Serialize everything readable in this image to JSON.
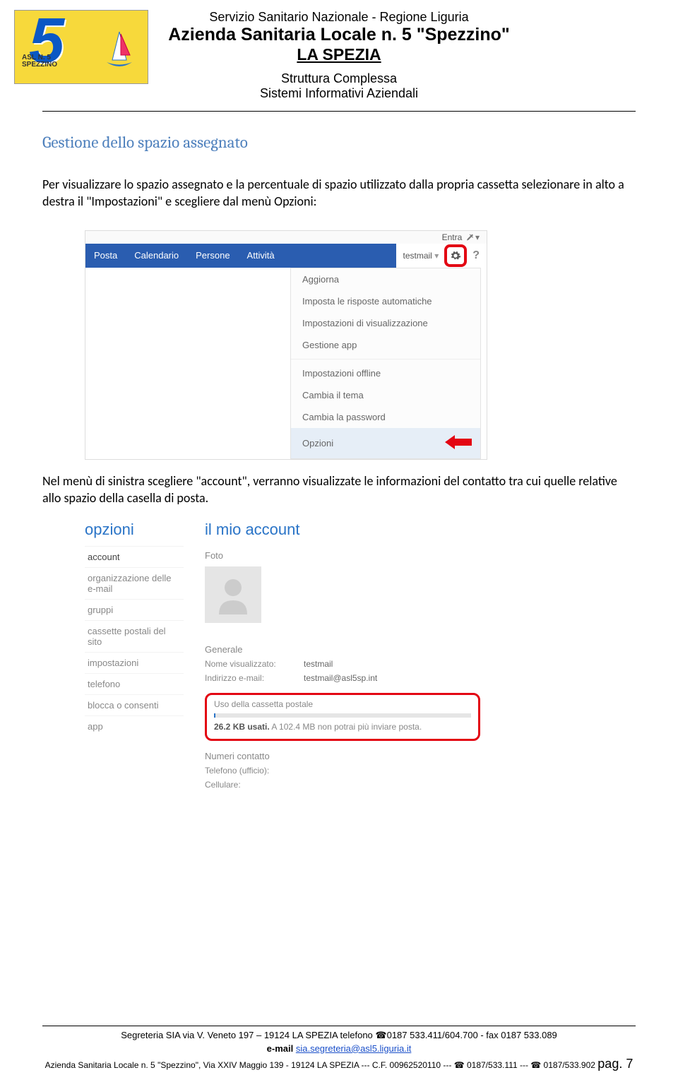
{
  "header": {
    "logo_text1": "ASL N. 5",
    "logo_text2": "SPEZZINO",
    "line1": "Servizio Sanitario Nazionale - Regione Liguria",
    "line2": "Azienda Sanitaria Locale n. 5 \"Spezzino\"",
    "line3": "LA SPEZIA",
    "line4": "Struttura Complessa",
    "line5": "Sistemi Informativi Aziendali"
  },
  "section_title": "Gestione dello spazio assegnato",
  "paragraph1": "Per visualizzare lo spazio assegnato e la percentuale di spazio utilizzato dalla propria cassetta selezionare in alto a destra il \"Impostazioni\" e scegliere dal menù Opzioni:",
  "screenshot1": {
    "entra": "Entra",
    "nav": {
      "posta": "Posta",
      "calendario": "Calendario",
      "persone": "Persone",
      "attivita": "Attività"
    },
    "user": "testmail",
    "help": "?",
    "dropdown": {
      "aggiorna": "Aggiorna",
      "risposte": "Imposta le risposte automatiche",
      "visualizzazione": "Impostazioni di visualizzazione",
      "gestione_app": "Gestione app",
      "offline": "Impostazioni offline",
      "tema": "Cambia il tema",
      "password": "Cambia la password",
      "opzioni": "Opzioni"
    }
  },
  "paragraph2": "Nel  menù di sinistra scegliere \"account\", verranno visualizzate le informazioni del contatto tra cui quelle relative allo spazio della casella di posta.",
  "screenshot2": {
    "sidebar": {
      "title": "opzioni",
      "items": {
        "account": "account",
        "org": "organizzazione delle e-mail",
        "gruppi": "gruppi",
        "cassette": "cassette postali del sito",
        "impostazioni": "impostazioni",
        "telefono": "telefono",
        "blocca": "blocca o consenti",
        "app": "app"
      }
    },
    "main": {
      "title": "il mio account",
      "foto": "Foto",
      "generale": "Generale",
      "nome_visualizzato_k": "Nome visualizzato:",
      "nome_visualizzato_v": "testmail",
      "indirizzo_k": "Indirizzo e-mail:",
      "indirizzo_v": "testmail@asl5sp.int",
      "uso_label": "Uso della cassetta postale",
      "uso_line": "26.2 KB usati. A 102.4 MB non potrai più inviare posta.",
      "uso_bold": "26.2 KB usati.",
      "uso_rest": " A 102.4 MB non potrai più inviare posta.",
      "numeri": "Numeri contatto",
      "tel_ufficio": "Telefono (ufficio):",
      "cellulare": "Cellulare:"
    }
  },
  "footer": {
    "line1": "Segreteria SIA via V. Veneto 197 – 19124 LA SPEZIA  telefono ☎0187 533.411/604.700 - fax 0187 533.089",
    "email_label": "e-mail",
    "email_link": "sia.segreteria@asl5.liguria.it",
    "line3_a": "Azienda  Sanitaria Locale n.  5 \"Spezzino\", Via XXIV Maggio 139 - 19124 LA SPEZIA --- C.F. 00962520110 --- ☎ 0187/533.111 --- ☎ 0187/533.902 ",
    "page_label": "pag. ",
    "page_num": "7"
  }
}
